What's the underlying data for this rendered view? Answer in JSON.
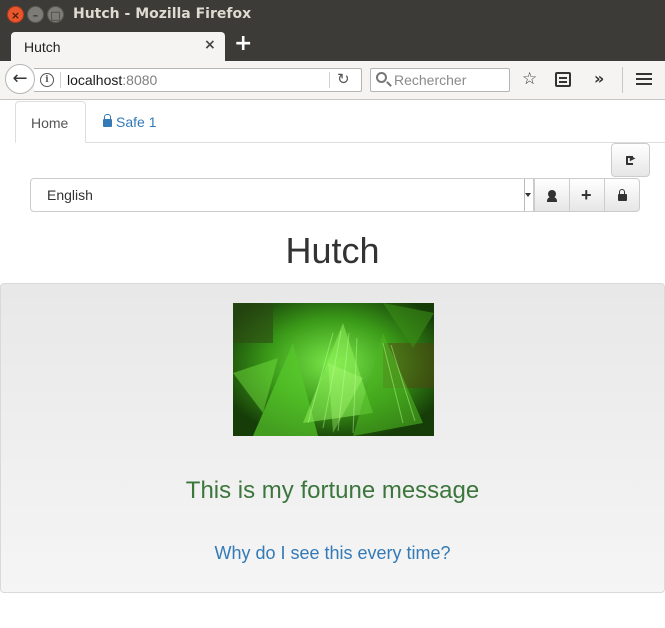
{
  "window": {
    "title": "Hutch - Mozilla Firefox",
    "close_glyph": "×",
    "min_glyph": "–",
    "max_glyph": "□"
  },
  "browser": {
    "tab_title": "Hutch",
    "tab_close_glyph": "×",
    "new_tab_glyph": "+",
    "back_glyph": "←",
    "url_host": "localhost",
    "url_port": ":8080",
    "search_placeholder": "Rechercher",
    "star_glyph": "☆",
    "overflow_glyph": "»",
    "reload_glyph": "↻",
    "info_glyph": "i"
  },
  "nav": {
    "tabs": [
      {
        "label": "Home",
        "active": true
      },
      {
        "label": "Safe 1",
        "active": false,
        "icon": "lock-icon"
      }
    ]
  },
  "toolbar": {
    "language_selected": "English",
    "buttons": [
      {
        "name": "logout-button",
        "icon": "logout-icon"
      },
      {
        "name": "user-button",
        "icon": "user-icon"
      },
      {
        "name": "add-button",
        "icon": "plus-icon",
        "glyph": "+"
      },
      {
        "name": "lock-button",
        "icon": "lock-icon"
      }
    ]
  },
  "main": {
    "title": "Hutch",
    "fortune_message": "This is my fortune message",
    "fortune_link": "Why do I see this every time?"
  },
  "colors": {
    "title_bar": "#3c3b37",
    "link": "#337ab7",
    "success_text": "#3c763d",
    "close_button": "#e8572d"
  }
}
